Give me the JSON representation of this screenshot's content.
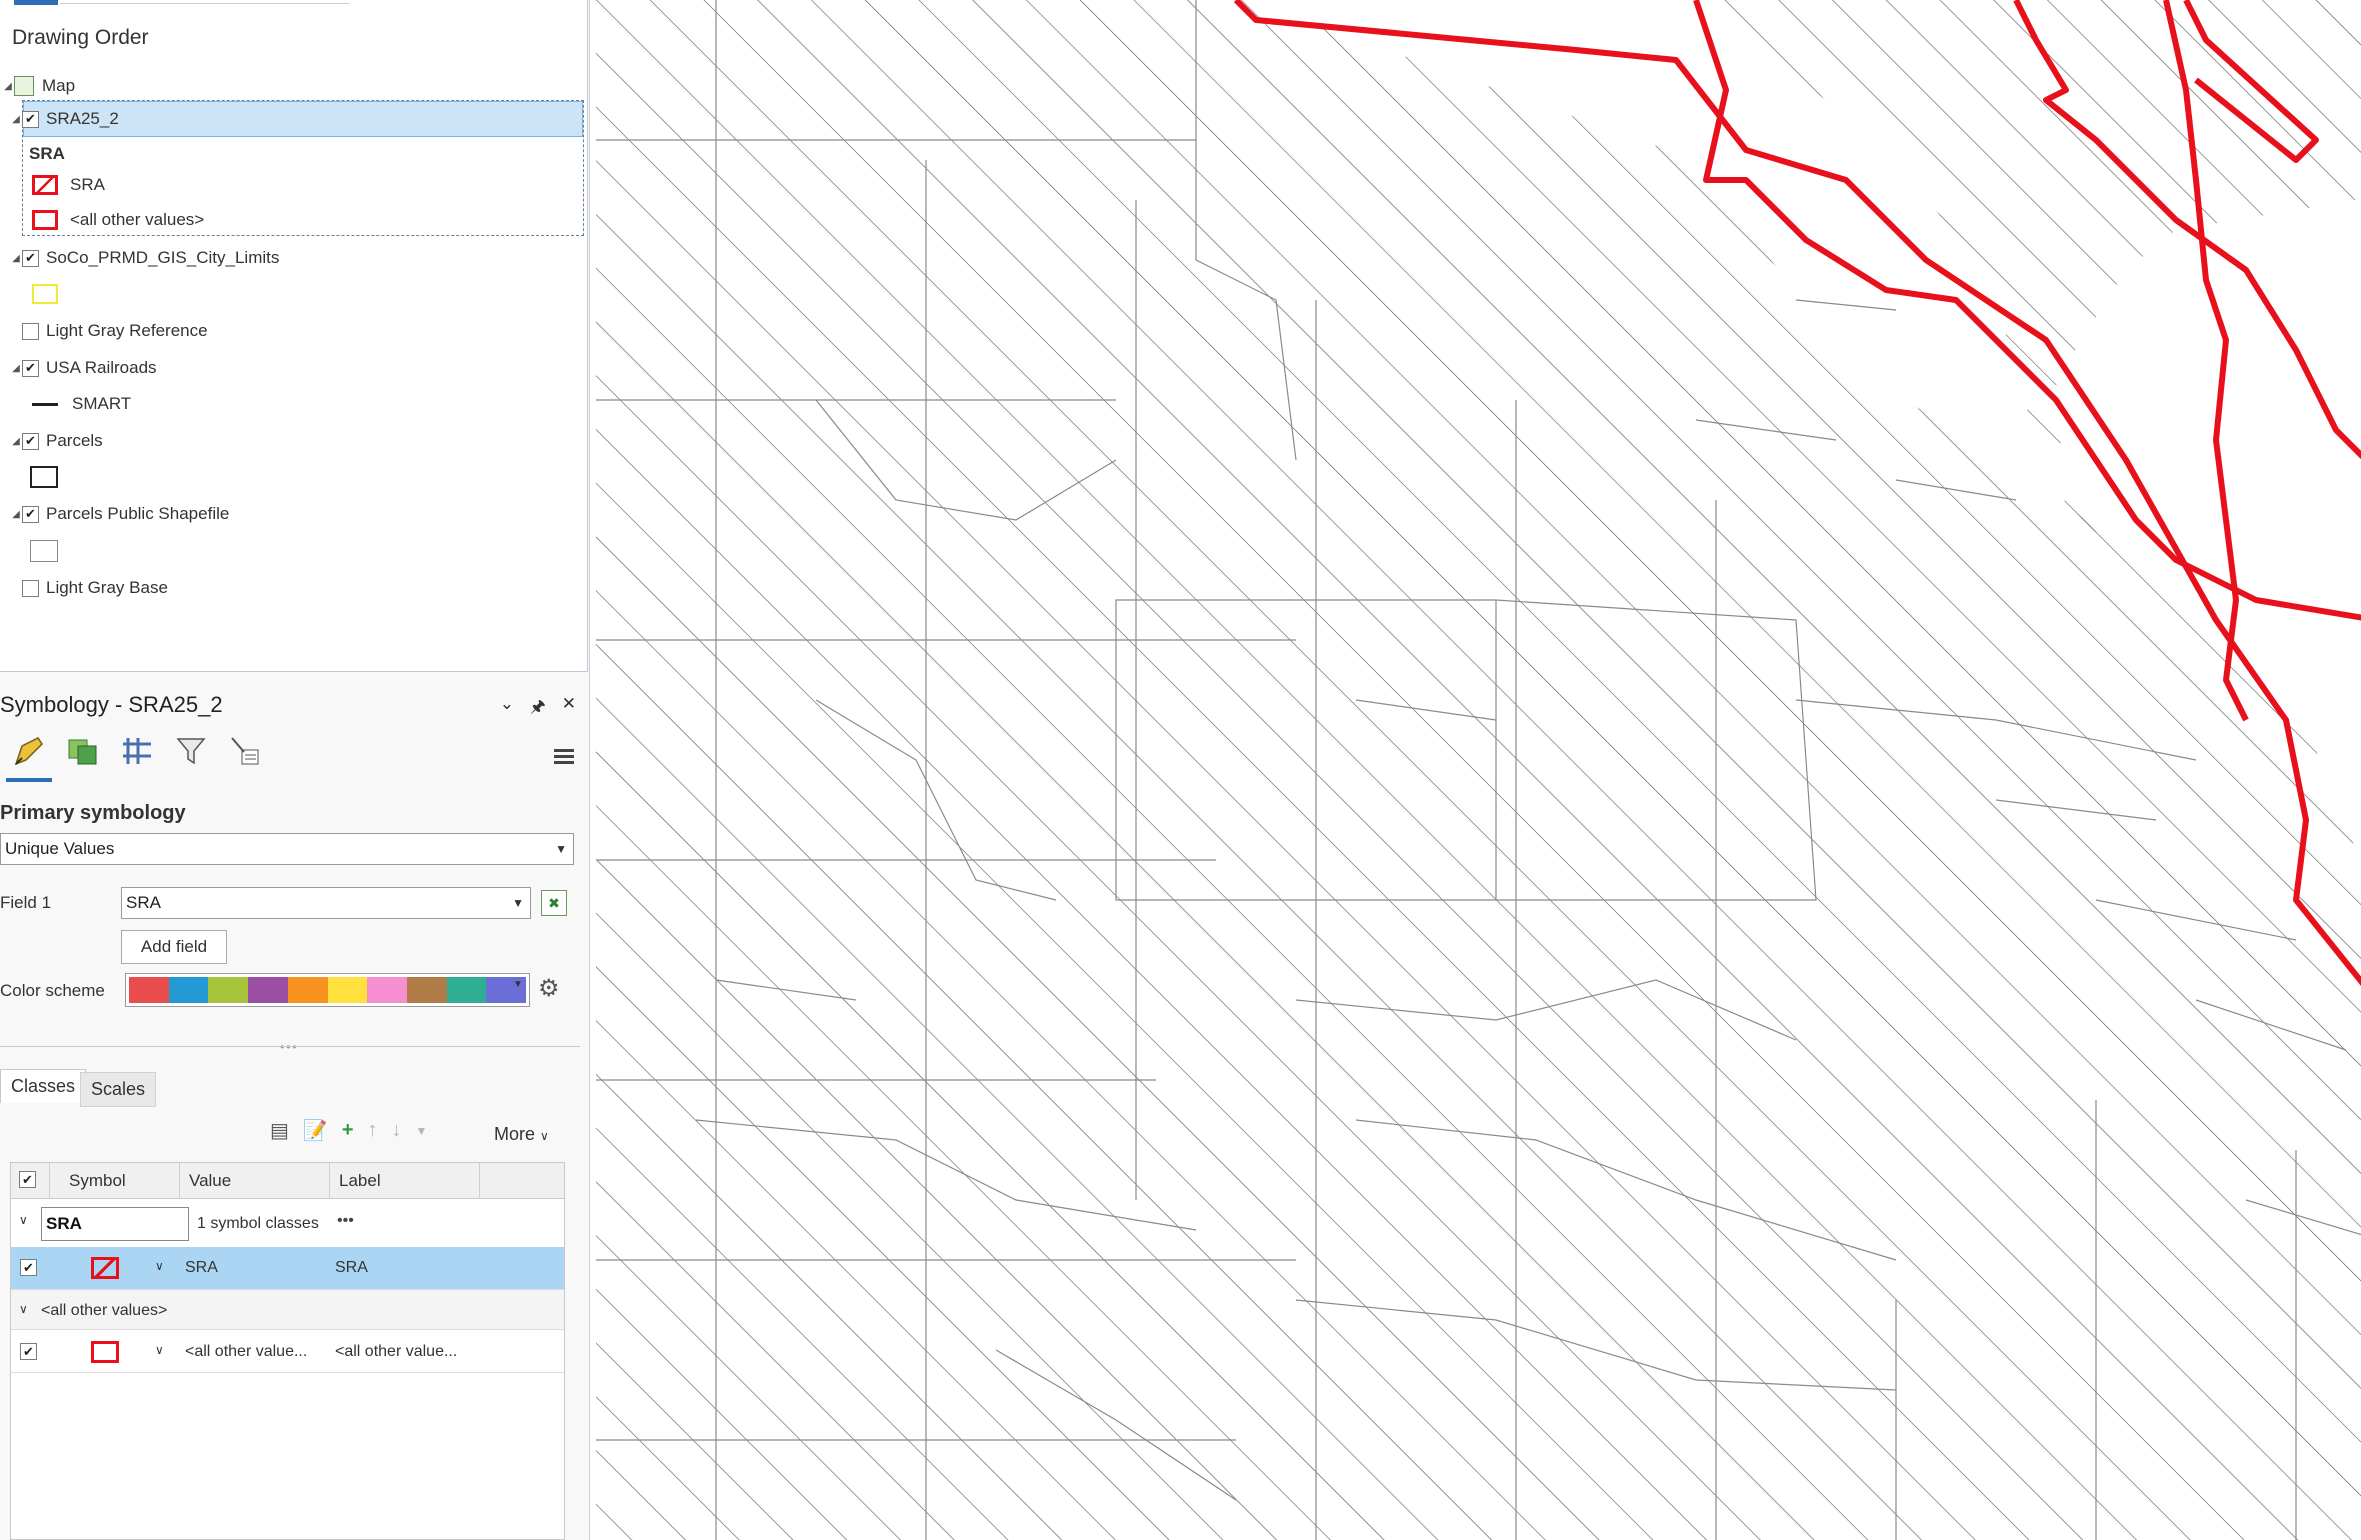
{
  "contents": {
    "heading": "Drawing Order",
    "map_label": "Map",
    "layers": [
      {
        "name": "SRA25_2",
        "checked": true
      },
      {
        "name": "SoCo_PRMD_GIS_City_Limits",
        "checked": true
      },
      {
        "name": "Light Gray Reference",
        "checked": false
      },
      {
        "name": "USA Railroads",
        "checked": true
      },
      {
        "name": "Parcels",
        "checked": true
      },
      {
        "name": "Parcels Public Shapefile",
        "checked": true
      },
      {
        "name": "Light Gray Base",
        "checked": false
      }
    ],
    "sra_group_heading": "SRA",
    "sra_classes": [
      "SRA",
      "<all other values>"
    ],
    "railroad_class": "SMART"
  },
  "symbology": {
    "title": "Symbology - SRA25_2",
    "primary_heading": "Primary symbology",
    "method": "Unique Values",
    "field1_label": "Field 1",
    "field1_value": "SRA",
    "add_field_label": "Add field",
    "color_scheme_label": "Color scheme",
    "color_scheme": [
      "#e84c4c",
      "#2499d3",
      "#a7c33a",
      "#9b4fa3",
      "#f7921e",
      "#ffe03c",
      "#f58fcf",
      "#b07d48",
      "#2fae93",
      "#6a6ed6"
    ],
    "tabs": [
      "Classes",
      "Scales"
    ],
    "more_label": "More",
    "columns": [
      "Symbol",
      "Value",
      "Label"
    ],
    "group_name": "SRA",
    "group_count": "1 symbol classes",
    "group_menu": "•••",
    "rows": [
      {
        "value": "SRA",
        "label": "SRA"
      }
    ],
    "other_heading": "<all other values>",
    "other_row": {
      "value": "<all other value...",
      "label": "<all other value..."
    }
  },
  "colors": {
    "sra_boundary": "#e8101a",
    "city_limits": "#f1ea31",
    "railroad": "#111111",
    "parcel_line": "#8a8a8a"
  }
}
